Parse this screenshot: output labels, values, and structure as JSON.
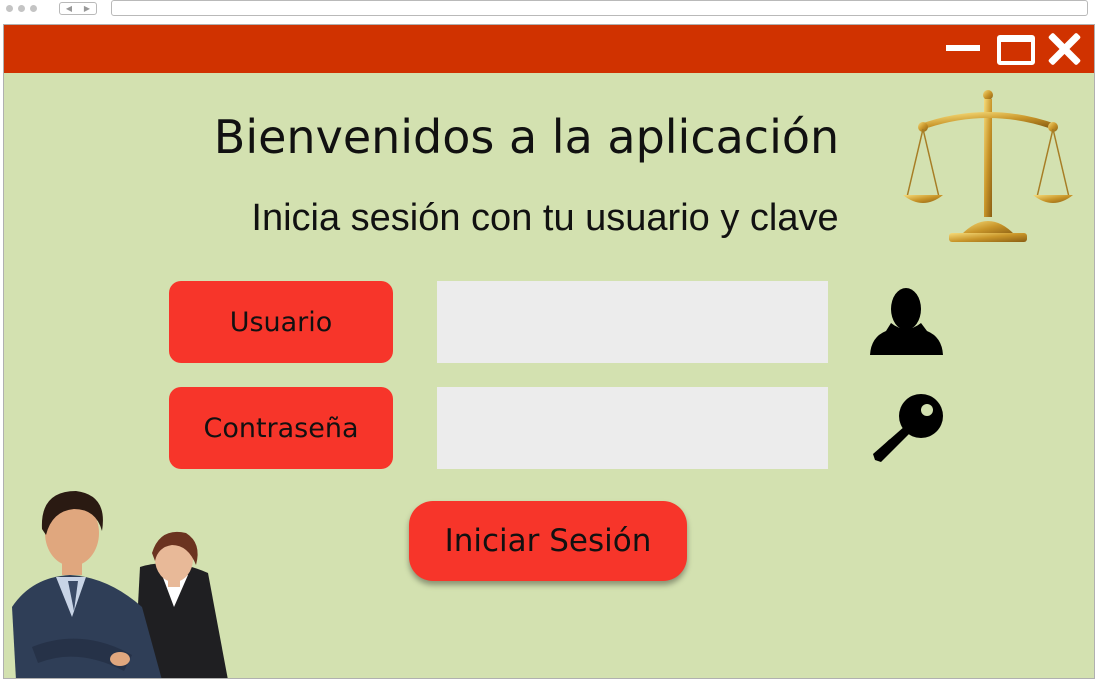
{
  "app": {
    "title": "Bienvenidos a la aplicación",
    "subtitle": "Inicia sesión con tu usuario y clave"
  },
  "form": {
    "username_label": "Usuario",
    "username_value": "",
    "username_placeholder": "",
    "password_label": "Contraseña",
    "password_value": "",
    "password_placeholder": "",
    "submit_label": "Iniciar Sesión"
  },
  "icons": {
    "scales": "scales-of-justice-icon",
    "user": "user-icon",
    "key": "key-icon",
    "people": "business-people-image"
  },
  "colors": {
    "titlebar": "#d03200",
    "background": "#d3e1b0",
    "button": "#f7352a",
    "field": "#ececec"
  }
}
